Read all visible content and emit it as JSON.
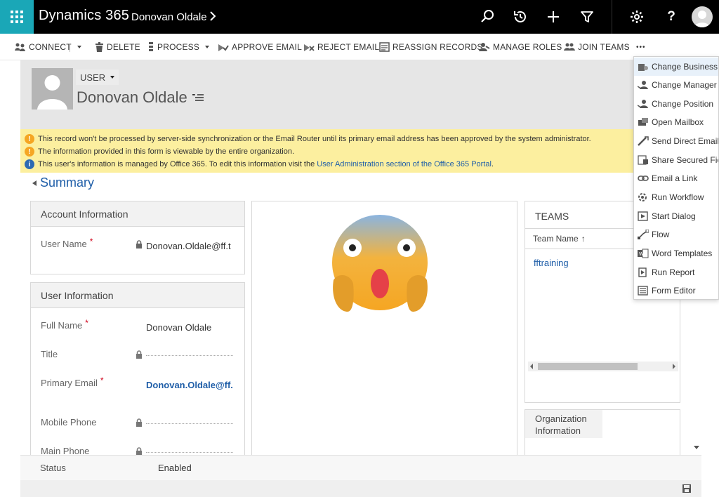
{
  "topbar": {
    "app_title": "Dynamics 365",
    "record_crumb": "Donovan Oldale",
    "icons": [
      "waffle-icon",
      "chevron-right-icon",
      "search-icon",
      "history-icon",
      "plus-icon",
      "filter-icon",
      "gear-icon",
      "help-icon",
      "user-avatar-icon"
    ],
    "help_label": "?",
    "accent_color": "#1aa7b7"
  },
  "commands": {
    "connect": "CONNECT",
    "delete": "DELETE",
    "process": "PROCESS",
    "approve_email": "APPROVE EMAIL",
    "reject_email": "REJECT EMAIL",
    "reassign_records": "REASSIGN RECORDS",
    "manage_roles": "MANAGE ROLES",
    "join_teams": "JOIN TEAMS",
    "more": "•••"
  },
  "header": {
    "entity_label": "USER",
    "record_name": "Donovan Oldale"
  },
  "notifications": {
    "items": [
      {
        "type": "warning",
        "text": "This record won't be processed by server-side synchronization or the Email Router until its primary email address has been approved by the system administrator."
      },
      {
        "type": "warning",
        "text": "The information provided in this form is viewable by the entire organization."
      },
      {
        "type": "info",
        "text": "This user's information is managed by Office 365. To edit this information visit the ",
        "link": "User Administration section of the Office 365 Portal",
        "suffix": "."
      }
    ]
  },
  "summary": {
    "heading": "Summary",
    "account_info": {
      "title": "Account Information",
      "user_name_label": "User Name",
      "user_name_value": "Donovan.Oldale@ff.t"
    },
    "user_info": {
      "title": "User Information",
      "full_name_label": "Full Name",
      "full_name_value": "Donovan Oldale",
      "title_label": "Title",
      "primary_email_label": "Primary Email",
      "primary_email_value": "Donovan.Oldale@ff.",
      "mobile_phone_label": "Mobile Phone",
      "main_phone_label": "Main Phone"
    },
    "required_marker": "*"
  },
  "teams": {
    "title": "TEAMS",
    "column_header": "Team Name",
    "sort_glyph": "↑",
    "rows": [
      "fftraining"
    ]
  },
  "org_info": {
    "title_line1": "Organization",
    "title_line2": "Information"
  },
  "footer": {
    "status_label": "Status",
    "status_value": "Enabled"
  },
  "more_menu": {
    "items": [
      {
        "label": "Change Business U",
        "icon": "business-unit-icon",
        "highlighted": true
      },
      {
        "label": "Change Manager",
        "icon": "manager-icon"
      },
      {
        "label": "Change Position",
        "icon": "position-icon"
      },
      {
        "label": "Open Mailbox",
        "icon": "mailbox-icon"
      },
      {
        "label": "Send Direct Email",
        "icon": "direct-email-icon"
      },
      {
        "label": "Share Secured Field",
        "icon": "share-field-icon"
      },
      {
        "label": "Email a Link",
        "icon": "email-link-icon"
      },
      {
        "label": "Run Workflow",
        "icon": "workflow-icon"
      },
      {
        "label": "Start Dialog",
        "icon": "dialog-icon"
      },
      {
        "label": "Flow",
        "icon": "flow-icon"
      },
      {
        "label": "Word Templates",
        "icon": "word-templates-icon"
      },
      {
        "label": "Run Report",
        "icon": "report-icon"
      },
      {
        "label": "Form Editor",
        "icon": "form-editor-icon"
      }
    ]
  }
}
